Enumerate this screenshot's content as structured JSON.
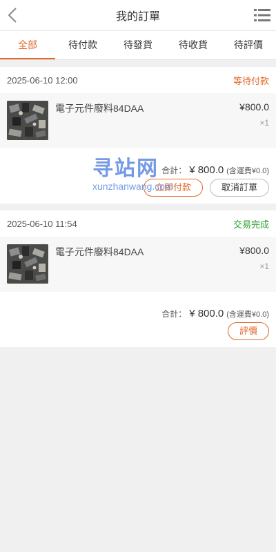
{
  "header": {
    "title": "我的訂單"
  },
  "tabs": [
    {
      "label": "全部",
      "active": true
    },
    {
      "label": "待付款",
      "active": false
    },
    {
      "label": "待發貨",
      "active": false
    },
    {
      "label": "待收貨",
      "active": false
    },
    {
      "label": "待評價",
      "active": false
    }
  ],
  "orders": [
    {
      "time": "2025-06-10 12:00",
      "status": "等待付款",
      "status_color": "#e4672a",
      "item": {
        "name": "電子元件廢料84DAA",
        "price": "¥800.0",
        "qty": "×1"
      },
      "summary": {
        "label": "合計：",
        "amount": "¥ 800.0",
        "fee": "(含運費¥0.0)"
      },
      "actions": [
        "立即付款",
        "取消訂單"
      ]
    },
    {
      "time": "2025-06-10 11:54",
      "status": "交易完成",
      "status_color": "#2ca02c",
      "item": {
        "name": "電子元件廢料84DAA",
        "price": "¥800.0",
        "qty": "×1"
      },
      "summary": {
        "label": "合計：",
        "amount": "¥ 800.0",
        "fee": "(含運費¥0.0)"
      },
      "actions": [
        "評價"
      ]
    }
  ],
  "watermark": {
    "text": "寻站网",
    "url": "xunzhanwang.com"
  },
  "colors": {
    "accent": "#e4672a",
    "success": "#2ca02c"
  },
  "icons": {
    "back": "chevron-left-icon",
    "menu": "list-menu-icon"
  }
}
